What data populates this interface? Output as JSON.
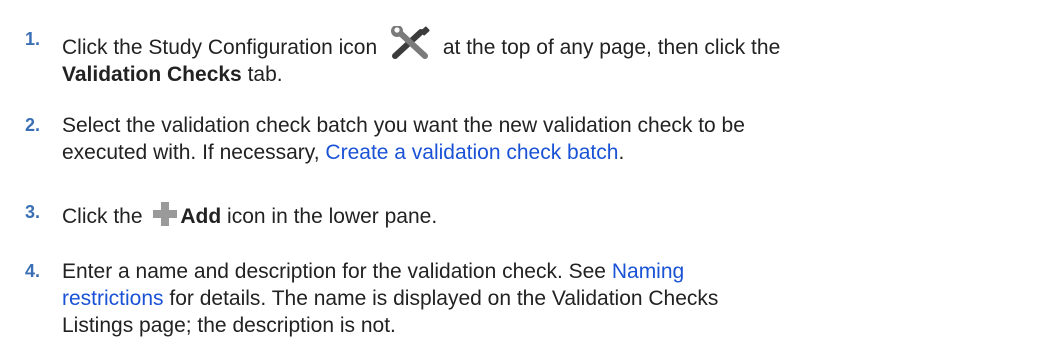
{
  "colors": {
    "step_number": "#3a6fb5",
    "link": "#1a52d6",
    "text": "#222222"
  },
  "steps": [
    {
      "number": "1.",
      "before_icon": "Click the Study Configuration icon",
      "icon": "tools-icon",
      "after_icon": "at the top of any page, then click the",
      "bold": "Validation Checks",
      "tail": "tab."
    },
    {
      "number": "2.",
      "text": "Select the validation check batch you want the new validation check to be executed with. If necessary,",
      "link": "Create a validation check batch",
      "tail": "."
    },
    {
      "number": "3.",
      "before_icon": "Click the",
      "icon": "add-icon",
      "bold": "Add",
      "tail": "icon in the lower pane."
    },
    {
      "number": "4.",
      "before_link": "Enter a name and description for the validation check. See",
      "link": "Naming restrictions",
      "tail": "for details. The name is displayed on the Validation Checks Listings page; the description is not."
    }
  ]
}
